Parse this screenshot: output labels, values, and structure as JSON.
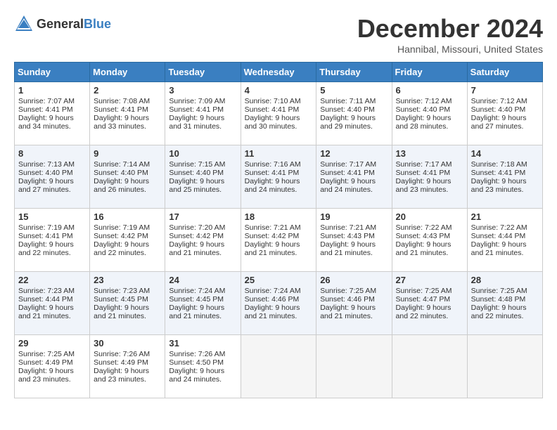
{
  "logo": {
    "text_general": "General",
    "text_blue": "Blue"
  },
  "title": "December 2024",
  "location": "Hannibal, Missouri, United States",
  "days_of_week": [
    "Sunday",
    "Monday",
    "Tuesday",
    "Wednesday",
    "Thursday",
    "Friday",
    "Saturday"
  ],
  "weeks": [
    [
      {
        "day": "1",
        "sunrise": "Sunrise: 7:07 AM",
        "sunset": "Sunset: 4:41 PM",
        "daylight": "Daylight: 9 hours and 34 minutes."
      },
      {
        "day": "2",
        "sunrise": "Sunrise: 7:08 AM",
        "sunset": "Sunset: 4:41 PM",
        "daylight": "Daylight: 9 hours and 33 minutes."
      },
      {
        "day": "3",
        "sunrise": "Sunrise: 7:09 AM",
        "sunset": "Sunset: 4:41 PM",
        "daylight": "Daylight: 9 hours and 31 minutes."
      },
      {
        "day": "4",
        "sunrise": "Sunrise: 7:10 AM",
        "sunset": "Sunset: 4:41 PM",
        "daylight": "Daylight: 9 hours and 30 minutes."
      },
      {
        "day": "5",
        "sunrise": "Sunrise: 7:11 AM",
        "sunset": "Sunset: 4:40 PM",
        "daylight": "Daylight: 9 hours and 29 minutes."
      },
      {
        "day": "6",
        "sunrise": "Sunrise: 7:12 AM",
        "sunset": "Sunset: 4:40 PM",
        "daylight": "Daylight: 9 hours and 28 minutes."
      },
      {
        "day": "7",
        "sunrise": "Sunrise: 7:12 AM",
        "sunset": "Sunset: 4:40 PM",
        "daylight": "Daylight: 9 hours and 27 minutes."
      }
    ],
    [
      {
        "day": "8",
        "sunrise": "Sunrise: 7:13 AM",
        "sunset": "Sunset: 4:40 PM",
        "daylight": "Daylight: 9 hours and 27 minutes."
      },
      {
        "day": "9",
        "sunrise": "Sunrise: 7:14 AM",
        "sunset": "Sunset: 4:40 PM",
        "daylight": "Daylight: 9 hours and 26 minutes."
      },
      {
        "day": "10",
        "sunrise": "Sunrise: 7:15 AM",
        "sunset": "Sunset: 4:40 PM",
        "daylight": "Daylight: 9 hours and 25 minutes."
      },
      {
        "day": "11",
        "sunrise": "Sunrise: 7:16 AM",
        "sunset": "Sunset: 4:41 PM",
        "daylight": "Daylight: 9 hours and 24 minutes."
      },
      {
        "day": "12",
        "sunrise": "Sunrise: 7:17 AM",
        "sunset": "Sunset: 4:41 PM",
        "daylight": "Daylight: 9 hours and 24 minutes."
      },
      {
        "day": "13",
        "sunrise": "Sunrise: 7:17 AM",
        "sunset": "Sunset: 4:41 PM",
        "daylight": "Daylight: 9 hours and 23 minutes."
      },
      {
        "day": "14",
        "sunrise": "Sunrise: 7:18 AM",
        "sunset": "Sunset: 4:41 PM",
        "daylight": "Daylight: 9 hours and 23 minutes."
      }
    ],
    [
      {
        "day": "15",
        "sunrise": "Sunrise: 7:19 AM",
        "sunset": "Sunset: 4:41 PM",
        "daylight": "Daylight: 9 hours and 22 minutes."
      },
      {
        "day": "16",
        "sunrise": "Sunrise: 7:19 AM",
        "sunset": "Sunset: 4:42 PM",
        "daylight": "Daylight: 9 hours and 22 minutes."
      },
      {
        "day": "17",
        "sunrise": "Sunrise: 7:20 AM",
        "sunset": "Sunset: 4:42 PM",
        "daylight": "Daylight: 9 hours and 21 minutes."
      },
      {
        "day": "18",
        "sunrise": "Sunrise: 7:21 AM",
        "sunset": "Sunset: 4:42 PM",
        "daylight": "Daylight: 9 hours and 21 minutes."
      },
      {
        "day": "19",
        "sunrise": "Sunrise: 7:21 AM",
        "sunset": "Sunset: 4:43 PM",
        "daylight": "Daylight: 9 hours and 21 minutes."
      },
      {
        "day": "20",
        "sunrise": "Sunrise: 7:22 AM",
        "sunset": "Sunset: 4:43 PM",
        "daylight": "Daylight: 9 hours and 21 minutes."
      },
      {
        "day": "21",
        "sunrise": "Sunrise: 7:22 AM",
        "sunset": "Sunset: 4:44 PM",
        "daylight": "Daylight: 9 hours and 21 minutes."
      }
    ],
    [
      {
        "day": "22",
        "sunrise": "Sunrise: 7:23 AM",
        "sunset": "Sunset: 4:44 PM",
        "daylight": "Daylight: 9 hours and 21 minutes."
      },
      {
        "day": "23",
        "sunrise": "Sunrise: 7:23 AM",
        "sunset": "Sunset: 4:45 PM",
        "daylight": "Daylight: 9 hours and 21 minutes."
      },
      {
        "day": "24",
        "sunrise": "Sunrise: 7:24 AM",
        "sunset": "Sunset: 4:45 PM",
        "daylight": "Daylight: 9 hours and 21 minutes."
      },
      {
        "day": "25",
        "sunrise": "Sunrise: 7:24 AM",
        "sunset": "Sunset: 4:46 PM",
        "daylight": "Daylight: 9 hours and 21 minutes."
      },
      {
        "day": "26",
        "sunrise": "Sunrise: 7:25 AM",
        "sunset": "Sunset: 4:46 PM",
        "daylight": "Daylight: 9 hours and 21 minutes."
      },
      {
        "day": "27",
        "sunrise": "Sunrise: 7:25 AM",
        "sunset": "Sunset: 4:47 PM",
        "daylight": "Daylight: 9 hours and 22 minutes."
      },
      {
        "day": "28",
        "sunrise": "Sunrise: 7:25 AM",
        "sunset": "Sunset: 4:48 PM",
        "daylight": "Daylight: 9 hours and 22 minutes."
      }
    ],
    [
      {
        "day": "29",
        "sunrise": "Sunrise: 7:25 AM",
        "sunset": "Sunset: 4:49 PM",
        "daylight": "Daylight: 9 hours and 23 minutes."
      },
      {
        "day": "30",
        "sunrise": "Sunrise: 7:26 AM",
        "sunset": "Sunset: 4:49 PM",
        "daylight": "Daylight: 9 hours and 23 minutes."
      },
      {
        "day": "31",
        "sunrise": "Sunrise: 7:26 AM",
        "sunset": "Sunset: 4:50 PM",
        "daylight": "Daylight: 9 hours and 24 minutes."
      },
      null,
      null,
      null,
      null
    ]
  ]
}
